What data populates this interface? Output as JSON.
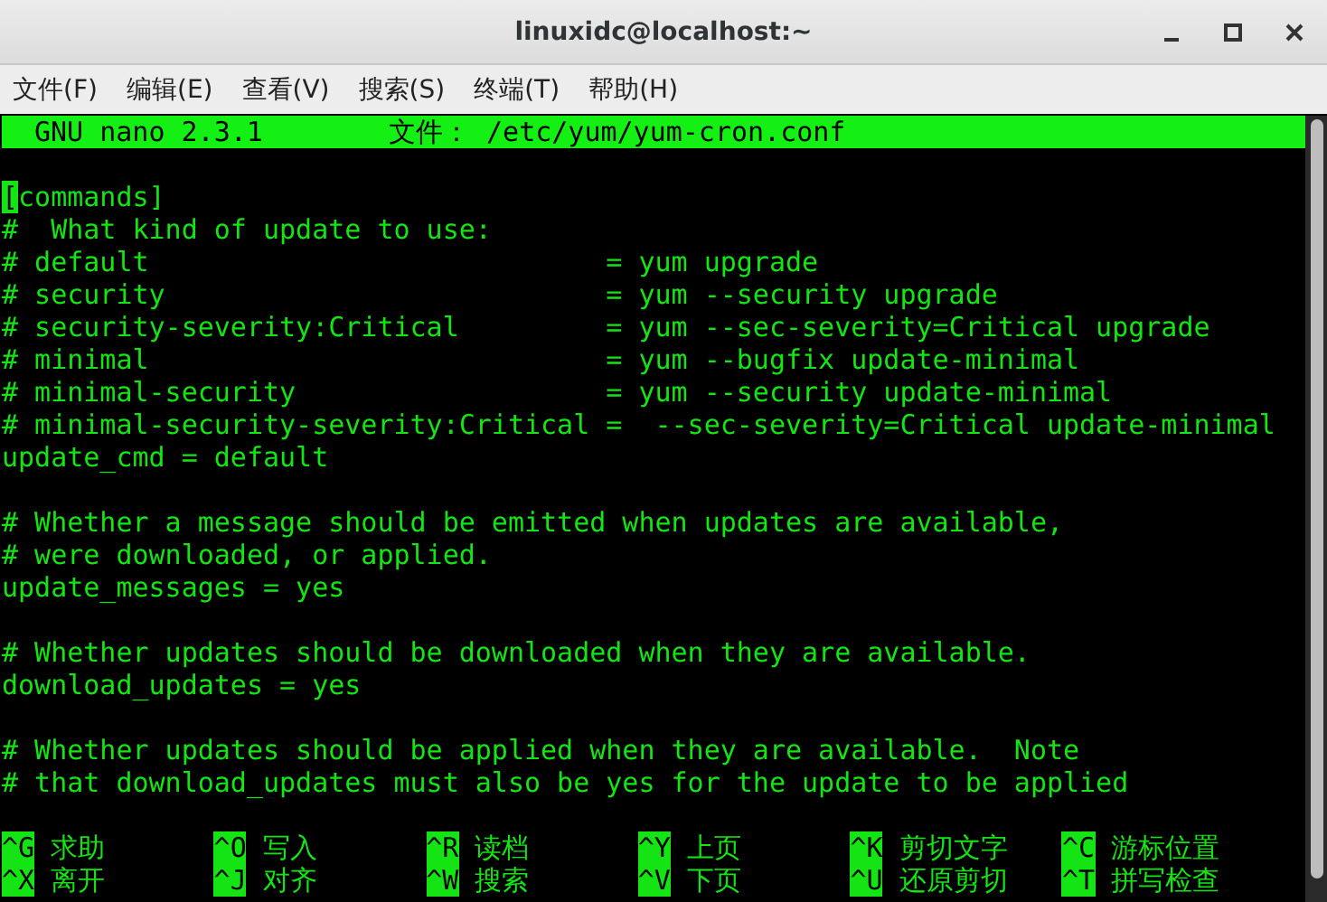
{
  "window": {
    "title": "linuxidc@localhost:~"
  },
  "menu": [
    "文件(F)",
    "编辑(E)",
    "查看(V)",
    "搜索(S)",
    "终端(T)",
    "帮助(H)"
  ],
  "editor": {
    "app": "GNU nano 2.3.1",
    "file": "文件： /etc/yum/yum-cron.conf",
    "blocks": [
      {
        "lines": [
          {
            "cursor": "[",
            "text": "commands]"
          },
          {
            "text": "#  What kind of update to use:"
          },
          {
            "text": "# default                            = yum upgrade"
          },
          {
            "text": "# security                           = yum --security upgrade"
          },
          {
            "text": "# security-severity:Critical         = yum --sec-severity=Critical upgrade"
          },
          {
            "text": "# minimal                            = yum --bugfix update-minimal"
          },
          {
            "text": "# minimal-security                   = yum --security update-minimal"
          },
          {
            "text": "# minimal-security-severity:Critical =  --sec-severity=Critical update-minimal"
          },
          {
            "text": "update_cmd = default"
          }
        ]
      },
      {
        "lines": [
          {
            "text": "# Whether a message should be emitted when updates are available,"
          },
          {
            "text": "# were downloaded, or applied."
          },
          {
            "text": "update_messages = yes"
          }
        ]
      },
      {
        "lines": [
          {
            "text": "# Whether updates should be downloaded when they are available."
          },
          {
            "text": "download_updates = yes"
          }
        ]
      },
      {
        "lines": [
          {
            "text": "# Whether updates should be applied when they are available.  Note"
          },
          {
            "text": "# that download_updates must also be yes for the update to be applied"
          }
        ]
      }
    ],
    "shortcuts": [
      {
        "key": "^G",
        "label": "求助"
      },
      {
        "key": "^O",
        "label": "写入"
      },
      {
        "key": "^R",
        "label": "读档"
      },
      {
        "key": "^Y",
        "label": "上页"
      },
      {
        "key": "^K",
        "label": "剪切文字"
      },
      {
        "key": "^C",
        "label": "游标位置"
      },
      {
        "key": "^X",
        "label": "离开"
      },
      {
        "key": "^J",
        "label": "对齐"
      },
      {
        "key": "^W",
        "label": "搜索"
      },
      {
        "key": "^V",
        "label": "下页"
      },
      {
        "key": "^U",
        "label": "还原剪切"
      },
      {
        "key": "^T",
        "label": "拼写检查"
      }
    ]
  }
}
